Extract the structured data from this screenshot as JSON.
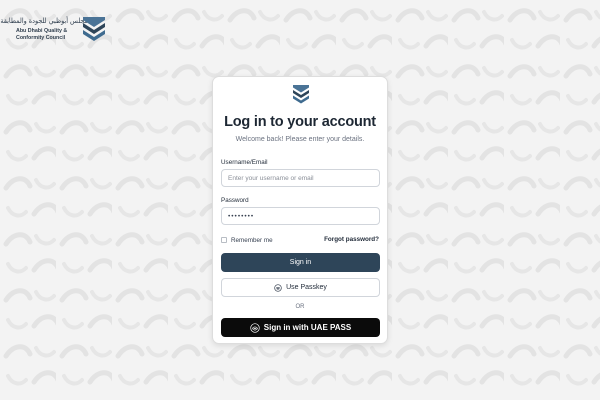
{
  "brand": {
    "name_ar": "مجلس أبوظبي للجودة والمطابقة",
    "name_en_line1": "Abu Dhabi Quality &",
    "name_en_line2": "Conformity Council",
    "logo_icon": "council-chevrons-logo"
  },
  "login": {
    "logo_icon": "council-chevrons-logo",
    "title": "Log in to your account",
    "subtitle": "Welcome back! Please enter your details.",
    "username_label": "Username/Email",
    "username_placeholder": "Enter your username or email",
    "username_value": "",
    "password_label": "Password",
    "password_value": "••••••••",
    "remember_label": "Remember me",
    "remember_checked": false,
    "forgot_label": "Forgot password?",
    "signin_label": "Sign in",
    "passkey_label": "Use Passkey",
    "passkey_icon": "fingerprint-icon",
    "or_label": "OR",
    "uaepass_label": "Sign in with UAE PASS",
    "uaepass_icon": "fingerprint-icon"
  },
  "colors": {
    "brand_navy": "#2e4559",
    "brand_accent": "#3f6b8f",
    "uaepass_black": "#0b0b0b",
    "background": "#f3f3f3"
  }
}
